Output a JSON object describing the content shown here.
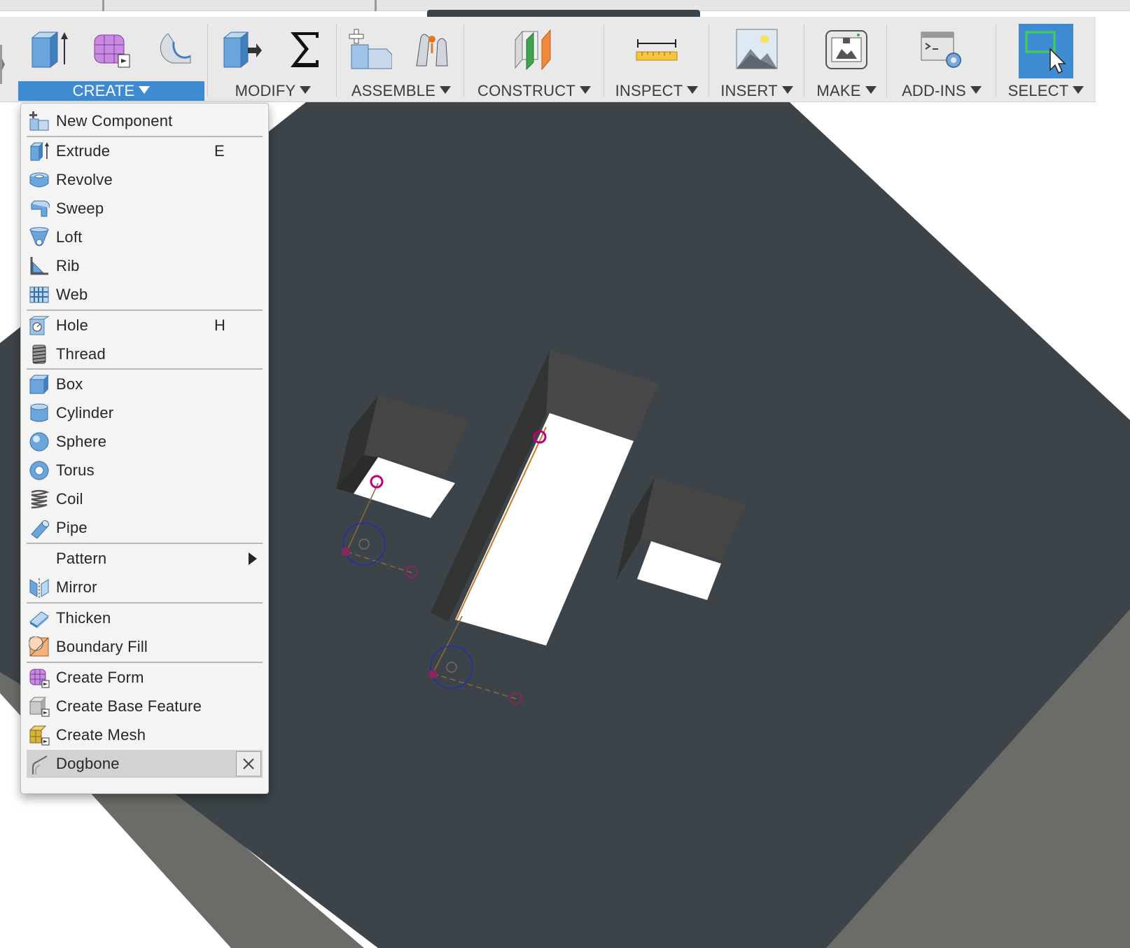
{
  "toolbar": {
    "groups": [
      {
        "label": "CREATE",
        "icons": [
          "extrude-icon",
          "create-form-icon",
          "sketch-curve-icon"
        ]
      },
      {
        "label": "MODIFY",
        "icons": [
          "press-pull-icon",
          "parameters-sigma-icon"
        ]
      },
      {
        "label": "ASSEMBLE",
        "icons": [
          "new-component-icon",
          "joint-icon"
        ]
      },
      {
        "label": "CONSTRUCT",
        "icons": [
          "offset-plane-icon"
        ]
      },
      {
        "label": "INSPECT",
        "icons": [
          "measure-icon"
        ]
      },
      {
        "label": "INSERT",
        "icons": [
          "insert-image-icon"
        ]
      },
      {
        "label": "MAKE",
        "icons": [
          "3d-print-icon"
        ]
      },
      {
        "label": "ADD-INS",
        "icons": [
          "scripts-addins-icon"
        ]
      },
      {
        "label": "SELECT",
        "icons": [
          "select-cursor-icon"
        ]
      }
    ],
    "active_group": "CREATE",
    "accent_color": "#3f8bd2"
  },
  "create_menu": {
    "items": [
      {
        "label": "New Component",
        "shortcut": "",
        "icon": "new-component-icon"
      },
      {
        "label": "Extrude",
        "shortcut": "E",
        "icon": "extrude-icon"
      },
      {
        "label": "Revolve",
        "shortcut": "",
        "icon": "revolve-icon"
      },
      {
        "label": "Sweep",
        "shortcut": "",
        "icon": "sweep-icon"
      },
      {
        "label": "Loft",
        "shortcut": "",
        "icon": "loft-icon"
      },
      {
        "label": "Rib",
        "shortcut": "",
        "icon": "rib-icon"
      },
      {
        "label": "Web",
        "shortcut": "",
        "icon": "web-icon"
      },
      {
        "label": "Hole",
        "shortcut": "H",
        "icon": "hole-icon"
      },
      {
        "label": "Thread",
        "shortcut": "",
        "icon": "thread-icon"
      },
      {
        "label": "Box",
        "shortcut": "",
        "icon": "box-icon"
      },
      {
        "label": "Cylinder",
        "shortcut": "",
        "icon": "cylinder-icon"
      },
      {
        "label": "Sphere",
        "shortcut": "",
        "icon": "sphere-icon"
      },
      {
        "label": "Torus",
        "shortcut": "",
        "icon": "torus-icon"
      },
      {
        "label": "Coil",
        "shortcut": "",
        "icon": "coil-icon"
      },
      {
        "label": "Pipe",
        "shortcut": "",
        "icon": "pipe-icon"
      },
      {
        "label": "Pattern",
        "shortcut": "",
        "icon": "",
        "submenu": true
      },
      {
        "label": "Mirror",
        "shortcut": "",
        "icon": "mirror-icon"
      },
      {
        "label": "Thicken",
        "shortcut": "",
        "icon": "thicken-icon"
      },
      {
        "label": "Boundary Fill",
        "shortcut": "",
        "icon": "boundary-fill-icon"
      },
      {
        "label": "Create Form",
        "shortcut": "",
        "icon": "create-form-icon"
      },
      {
        "label": "Create Base Feature",
        "shortcut": "",
        "icon": "create-base-feature-icon"
      },
      {
        "label": "Create Mesh",
        "shortcut": "",
        "icon": "create-mesh-icon"
      },
      {
        "label": "Dogbone",
        "shortcut": "",
        "icon": "dogbone-icon",
        "highlighted": true
      }
    ]
  },
  "colors": {
    "toolbar_bg": "#e9e9e9",
    "menu_bg": "#f4f4f4",
    "model_top": "#3c4449",
    "model_side": "#6b6b68",
    "pocket_floor": "#ffffff",
    "sketch_point": "#c0007a",
    "sketch_circle": "#1f2fb0",
    "sketch_line": "#b5651d"
  }
}
